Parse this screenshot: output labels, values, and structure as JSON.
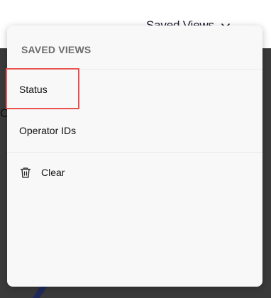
{
  "trigger": {
    "label": "Saved Views",
    "icon": "chevron-down-icon"
  },
  "backdrop": {
    "partial_text": "C"
  },
  "menu": {
    "header": "SAVED VIEWS",
    "items": [
      {
        "label": "Status"
      },
      {
        "label": "Operator IDs"
      }
    ],
    "clear": {
      "label": "Clear",
      "icon": "trash-icon"
    }
  },
  "colors": {
    "highlight": "#e8534f",
    "menu_bg": "#f8f8f8",
    "backdrop": "#3a3a3a",
    "accent_stroke": "#1f2a5a"
  }
}
